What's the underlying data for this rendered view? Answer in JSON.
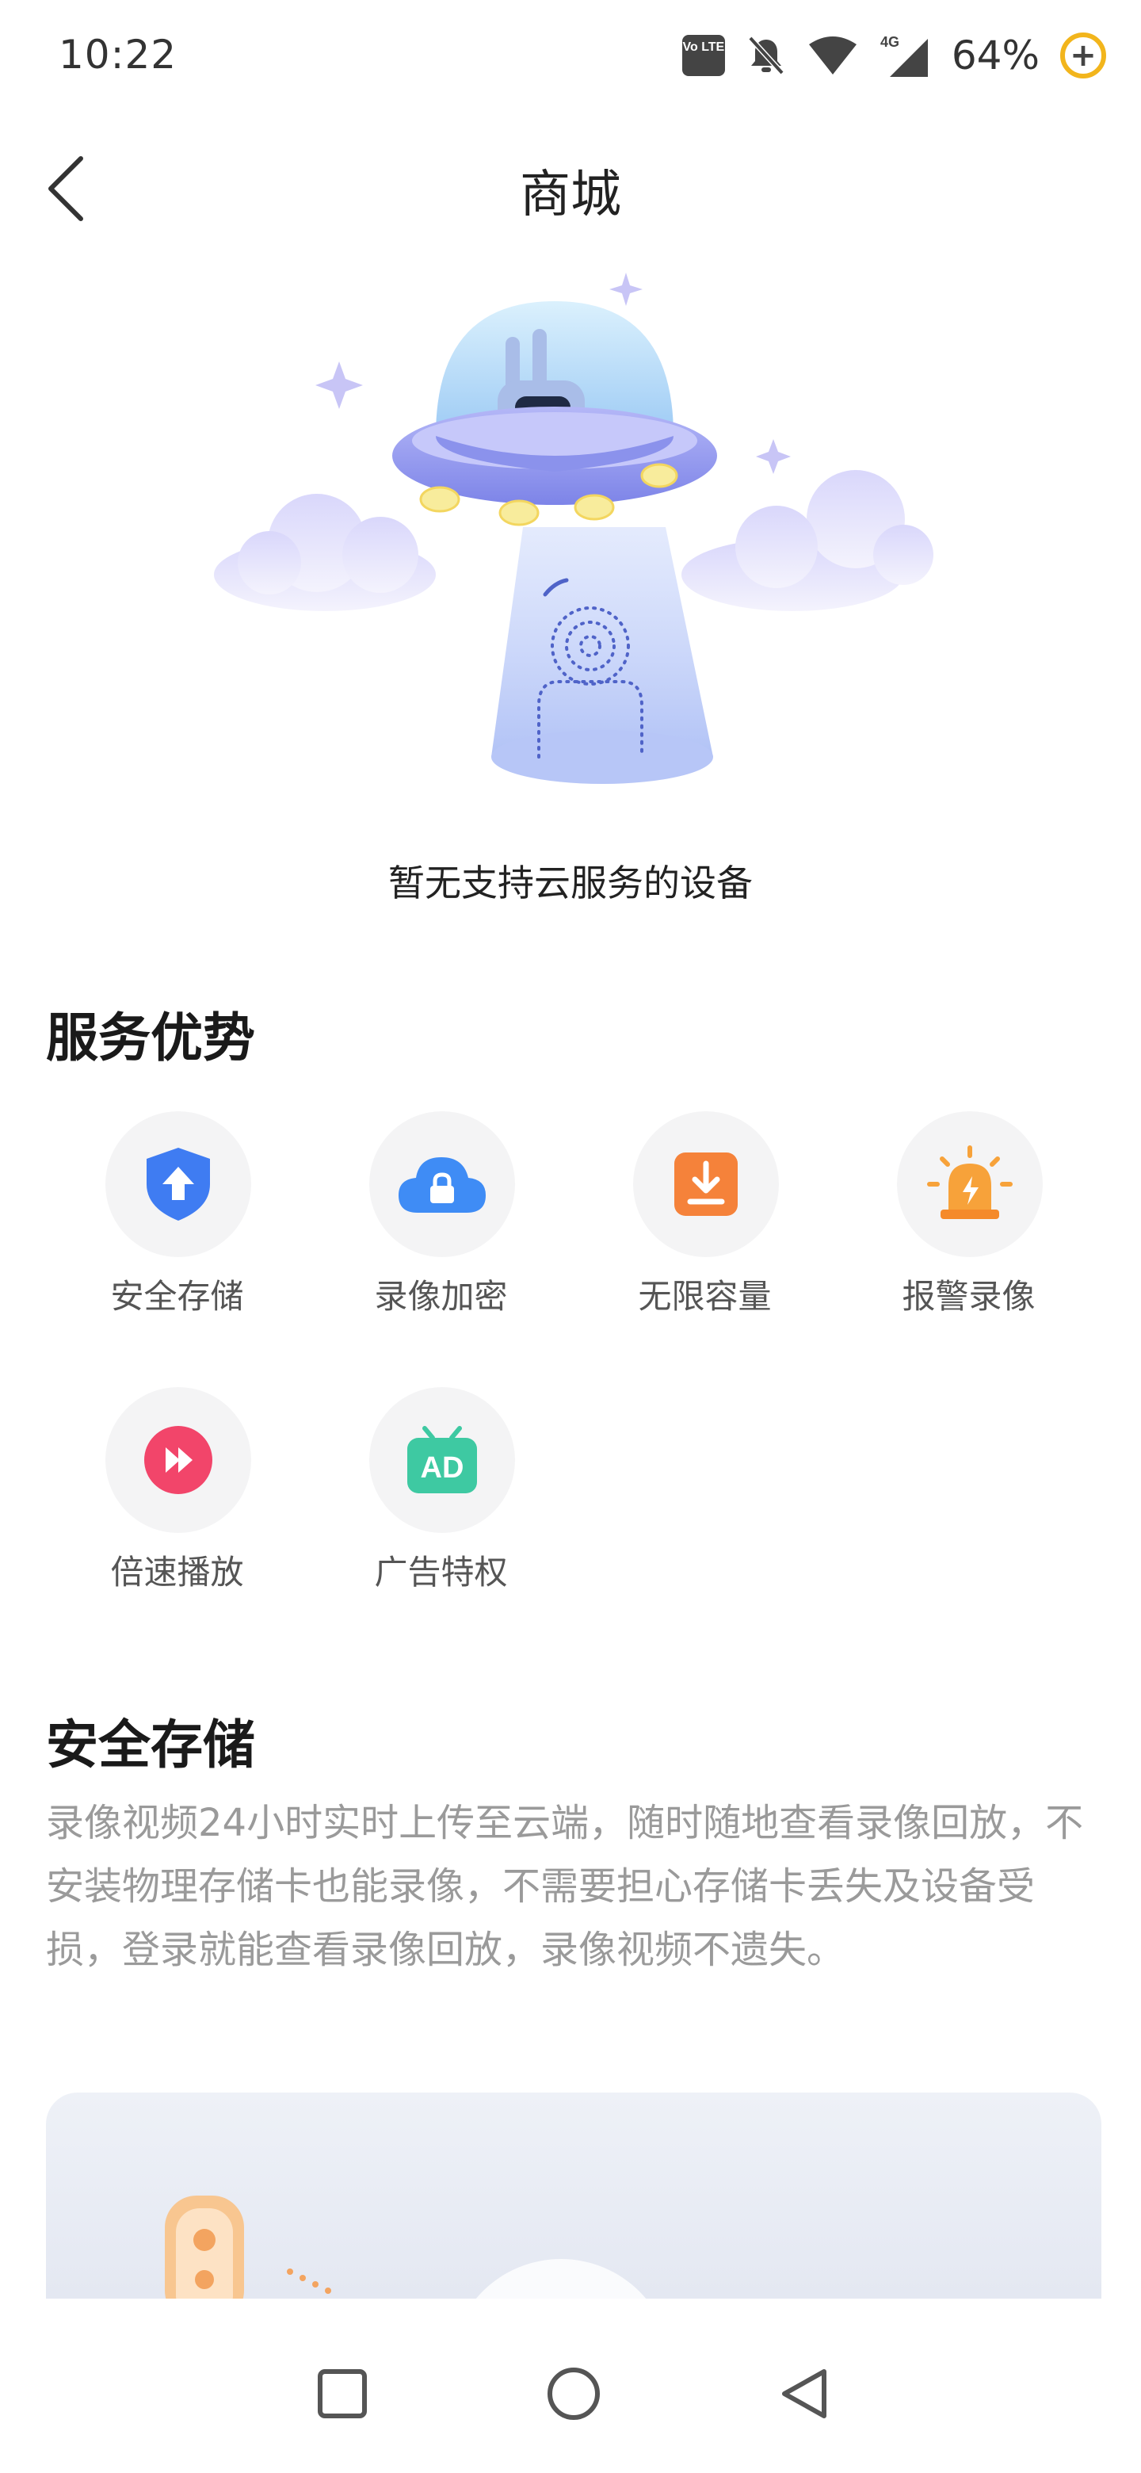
{
  "status": {
    "time": "10:22",
    "volte": "Vo LTE",
    "network": "4G",
    "battery": "64%",
    "battery_icon": "battery-saver-icon"
  },
  "header": {
    "title": "商城",
    "back_icon": "chevron-left-icon"
  },
  "empty_state": {
    "message": "暂无支持云服务的设备",
    "illustration": "ufo-camera-illustration"
  },
  "advantages": {
    "title": "服务优势",
    "items": [
      {
        "label": "安全存储",
        "icon": "shield-upload-icon",
        "color": "#3f7cf2"
      },
      {
        "label": "录像加密",
        "icon": "cloud-lock-icon",
        "color": "#3f8cf5"
      },
      {
        "label": "无限容量",
        "icon": "download-box-icon",
        "color": "#f5823a"
      },
      {
        "label": "报警录像",
        "icon": "alarm-light-icon",
        "color": "#f7a23a"
      },
      {
        "label": "倍速播放",
        "icon": "fast-forward-icon",
        "color": "#f2456a"
      },
      {
        "label": "广告特权",
        "icon": "ad-tv-icon",
        "color": "#3ec9a2"
      }
    ]
  },
  "detail": {
    "title": "安全存储",
    "description": "录像视频24小时实时上传至云端，随时随地查看录像回放，不安装物理存储卡也能录像，不需要担心存储卡丢失及设备受损，登录就能查看录像回放，录像视频不遗失。"
  },
  "navigation": {
    "recent_icon": "square-recents-icon",
    "home_icon": "circle-home-icon",
    "back_icon": "triangle-back-icon"
  }
}
